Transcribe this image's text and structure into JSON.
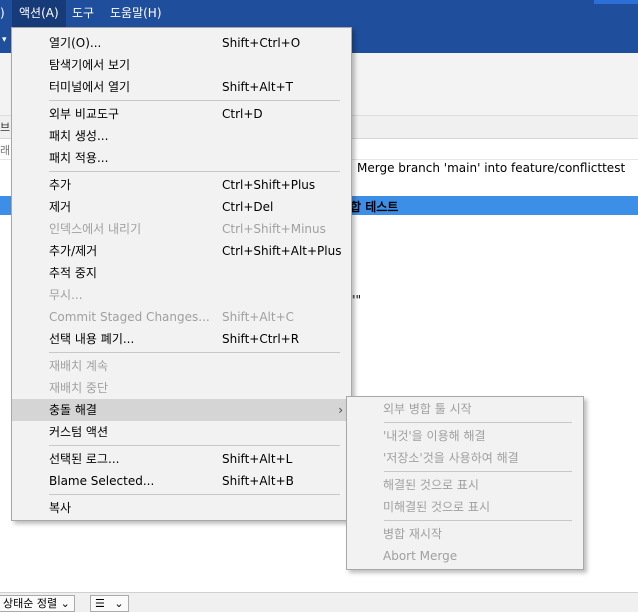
{
  "menubar": {
    "left_fragment": ")",
    "items": [
      {
        "label": "액션(A)",
        "active": true
      },
      {
        "label": "도구",
        "active": false
      },
      {
        "label": "도움말(H)",
        "active": false
      }
    ],
    "dropdown_glyph": "▾"
  },
  "background": {
    "panel_fragment_1": "브",
    "panel_fragment_2": "래",
    "commit_message": "Merge branch 'main' into feature/conflicttest",
    "selected_commit_text": "합 테스트",
    "quote_fragment": "\"\""
  },
  "statusbar": {
    "sort_label": "상태순 정렬",
    "chevron": "⌄",
    "list_icon": "☰"
  },
  "action_menu": {
    "groups": [
      [
        {
          "label": "열기(O)...",
          "shortcut": "Shift+Ctrl+O",
          "disabled": false
        },
        {
          "label": "탐색기에서 보기",
          "shortcut": "",
          "disabled": false
        },
        {
          "label": "터미널에서 열기",
          "shortcut": "Shift+Alt+T",
          "disabled": false
        }
      ],
      [
        {
          "label": "외부 비교도구",
          "shortcut": "Ctrl+D",
          "disabled": false
        },
        {
          "label": "패치 생성...",
          "shortcut": "",
          "disabled": false
        },
        {
          "label": "패치 적용...",
          "shortcut": "",
          "disabled": false
        }
      ],
      [
        {
          "label": "추가",
          "shortcut": "Ctrl+Shift+Plus",
          "disabled": false
        },
        {
          "label": "제거",
          "shortcut": "Ctrl+Del",
          "disabled": false
        },
        {
          "label": "인덱스에서 내리기",
          "shortcut": "Ctrl+Shift+Minus",
          "disabled": true
        },
        {
          "label": "추가/제거",
          "shortcut": "Ctrl+Shift+Alt+Plus",
          "disabled": false
        },
        {
          "label": "추적 중지",
          "shortcut": "",
          "disabled": false
        },
        {
          "label": "무시...",
          "shortcut": "",
          "disabled": true
        },
        {
          "label": "Commit Staged Changes...",
          "shortcut": "Shift+Alt+C",
          "disabled": true
        },
        {
          "label": "선택 내용 폐기...",
          "shortcut": "Shift+Ctrl+R",
          "disabled": false
        }
      ],
      [
        {
          "label": "재배치 계속",
          "shortcut": "",
          "disabled": true
        },
        {
          "label": "재배치 중단",
          "shortcut": "",
          "disabled": true
        },
        {
          "label": "충돌 해결",
          "shortcut": "",
          "disabled": false,
          "submenu": true,
          "highlighted": true
        },
        {
          "label": "커스텀 액션",
          "shortcut": "",
          "disabled": false
        }
      ],
      [
        {
          "label": "선택된 로그...",
          "shortcut": "Shift+Alt+L",
          "disabled": false
        },
        {
          "label": "Blame Selected...",
          "shortcut": "Shift+Alt+B",
          "disabled": false
        }
      ],
      [
        {
          "label": "복사",
          "shortcut": "",
          "disabled": false
        }
      ]
    ],
    "submenu_arrow": "›"
  },
  "conflict_submenu": {
    "groups": [
      [
        {
          "label": "외부 병합 툴 시작",
          "disabled": true
        }
      ],
      [
        {
          "label": "'내것'을 이용해 해결",
          "disabled": true
        },
        {
          "label": "'저장소'것을 사용하여 해결",
          "disabled": true
        }
      ],
      [
        {
          "label": "해결된 것으로 표시",
          "disabled": true
        },
        {
          "label": "미해결된 것으로 표시",
          "disabled": true
        }
      ],
      [
        {
          "label": "병합 재시작",
          "disabled": true
        },
        {
          "label": "Abort Merge",
          "disabled": true
        }
      ]
    ]
  }
}
